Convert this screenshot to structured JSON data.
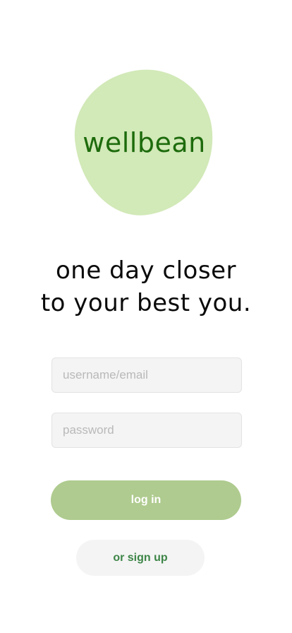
{
  "app": {
    "logo_text": "wellbean"
  },
  "tagline": {
    "line1": "one day closer",
    "line2": "to your best you."
  },
  "form": {
    "username_placeholder": "username/email",
    "username_value": "",
    "password_placeholder": "password",
    "password_value": ""
  },
  "actions": {
    "login_label": "log in",
    "signup_label": "or sign up"
  },
  "colors": {
    "logo_blob": "#d2e9b8",
    "logo_text": "#1d6b0c",
    "login_button": "#afcb8f",
    "signup_text": "#3d8547",
    "field_background": "#f4f4f4"
  }
}
